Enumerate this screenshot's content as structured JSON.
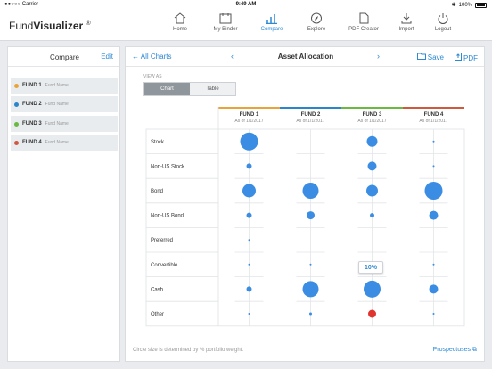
{
  "status": {
    "carrier": "●●○○○ Carrier",
    "time": "9:49 AM",
    "battery": "100%"
  },
  "app": {
    "name_light": "Fund",
    "name_bold": "Visualizer",
    "reg": "®"
  },
  "nav": [
    {
      "label": "Home",
      "icon": "home-icon",
      "active": false
    },
    {
      "label": "My Binder",
      "icon": "binder-icon",
      "active": false
    },
    {
      "label": "Compare",
      "icon": "bar-chart-icon",
      "active": true
    },
    {
      "label": "Explore",
      "icon": "compass-icon",
      "active": false
    },
    {
      "label": "PDF Creator",
      "icon": "document-icon",
      "active": false
    },
    {
      "label": "Import",
      "icon": "import-icon",
      "active": false
    },
    {
      "label": "Logout",
      "icon": "power-icon",
      "active": false
    }
  ],
  "sidebar": {
    "title": "Compare",
    "edit": "Edit",
    "funds": [
      {
        "code": "FUND 1",
        "name": "Fund Name",
        "color": "#e8a33b"
      },
      {
        "code": "FUND 2",
        "name": "Fund Name",
        "color": "#2a85c9"
      },
      {
        "code": "FUND 3",
        "name": "Fund Name",
        "color": "#6bb842"
      },
      {
        "code": "FUND 4",
        "name": "Fund Name",
        "color": "#d0583d"
      }
    ]
  },
  "main": {
    "back": "All Charts",
    "title": "Asset Allocation",
    "save": "Save",
    "pdf": "PDF",
    "view_as": "VIEW AS",
    "view_chart": "Chart",
    "view_table": "Table",
    "footnote": "Circle size is determined by % portfolio weight.",
    "prospectuses": "Prospectuses",
    "tooltip": "10%"
  },
  "chart_data": {
    "type": "scatter",
    "title": "Asset Allocation",
    "categories": [
      "Stock",
      "Non-US Stock",
      "Bond",
      "Non-US Bond",
      "Preferred",
      "Convertible",
      "Cash",
      "Other"
    ],
    "funds": [
      {
        "name": "FUND 1",
        "date": "As of 1/1/2017",
        "color": "#e8a33b"
      },
      {
        "name": "FUND 2",
        "date": "As of 1/1/2017",
        "color": "#2a85c9"
      },
      {
        "name": "FUND 3",
        "date": "As of 1/1/2017",
        "color": "#6bb842"
      },
      {
        "name": "FUND 4",
        "date": "As of 1/1/2017",
        "color": "#d0583d"
      }
    ],
    "weights_relative": [
      [
        1.0,
        0,
        0.6,
        0.1
      ],
      [
        0.3,
        0,
        0.5,
        0.1
      ],
      [
        0.75,
        0.9,
        0.65,
        1.0
      ],
      [
        0.3,
        0.45,
        0.25,
        0.5
      ],
      [
        0.1,
        0,
        0,
        0
      ],
      [
        0.1,
        0.1,
        0.1,
        0.1
      ],
      [
        0.3,
        0.9,
        0.95,
        0.5
      ],
      [
        0.1,
        0.15,
        0.45,
        0.1
      ]
    ],
    "highlight": [
      [
        7,
        2
      ]
    ],
    "bubble_color": "#3a8de3",
    "highlight_color": "#e0352e"
  }
}
